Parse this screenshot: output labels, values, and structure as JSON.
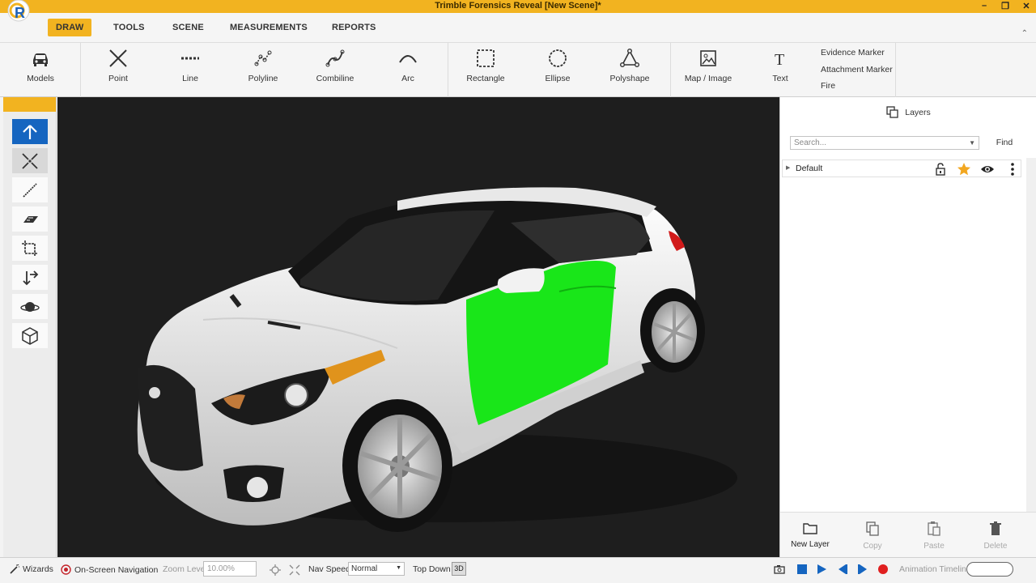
{
  "window": {
    "title": "Trimble Forensics Reveal [New Scene]*",
    "controls": [
      "minimize",
      "restore",
      "close"
    ]
  },
  "menu": {
    "tabs": [
      {
        "label": "DRAW",
        "active": true
      },
      {
        "label": "TOOLS"
      },
      {
        "label": "SCENE"
      },
      {
        "label": "MEASUREMENTS"
      },
      {
        "label": "REPORTS"
      }
    ],
    "accent_color": "#f2b320"
  },
  "ribbon": {
    "buttons": [
      {
        "label": "Models",
        "icon": "car-icon"
      },
      {
        "label": "Point",
        "icon": "x-point-icon"
      },
      {
        "label": "Line",
        "icon": "dashed-line-icon"
      },
      {
        "label": "Polyline",
        "icon": "polyline-icon"
      },
      {
        "label": "Combiline",
        "icon": "combiline-icon"
      },
      {
        "label": "Arc",
        "icon": "arc-icon"
      },
      {
        "label": "Rectangle",
        "icon": "rectangle-icon"
      },
      {
        "label": "Ellipse",
        "icon": "ellipse-icon"
      },
      {
        "label": "Polyshape",
        "icon": "polyshape-icon"
      },
      {
        "label": "Map / Image",
        "icon": "image-icon"
      },
      {
        "label": "Text",
        "icon": "text-icon"
      }
    ],
    "links": [
      "Evidence Marker",
      "Attachment Marker",
      "Fire"
    ]
  },
  "left_toolbar": {
    "tools": [
      {
        "name": "select-tool",
        "icon": "arrow-up-icon",
        "selected": true
      },
      {
        "name": "collapse-tool",
        "icon": "collapse-arrows-icon",
        "highlighted": true
      },
      {
        "name": "measure-tool",
        "icon": "diagonal-line-icon"
      },
      {
        "name": "ruler-tool",
        "icon": "ruler-icon"
      },
      {
        "name": "crop-tool",
        "icon": "crop-icon"
      },
      {
        "name": "move-tool",
        "icon": "move-arrows-icon"
      },
      {
        "name": "orbit-tool",
        "icon": "orbit-icon"
      },
      {
        "name": "cube-tool",
        "icon": "cube-icon"
      }
    ]
  },
  "viewport": {
    "background": "#1e1e1e",
    "highlight_color": "#19e619"
  },
  "layers_panel": {
    "header": "Layers",
    "search_placeholder": "Search...",
    "find_label": "Find",
    "layers": [
      {
        "name": "Default",
        "locked": false,
        "starred": true,
        "visible": true
      }
    ],
    "actions": [
      {
        "label": "New Layer",
        "icon": "folder-icon",
        "enabled": true
      },
      {
        "label": "Copy",
        "icon": "copy-icon",
        "enabled": false
      },
      {
        "label": "Paste",
        "icon": "paste-icon",
        "enabled": false
      },
      {
        "label": "Delete",
        "icon": "trash-icon",
        "enabled": false
      }
    ]
  },
  "status_bar": {
    "wizards": "Wizards",
    "onscreen_nav": "On-Screen Navigation",
    "zoom_label": "Zoom Level",
    "zoom_value": "10.00%",
    "nav_speed_label": "Nav Speed",
    "nav_speed_value": "Normal",
    "top_down": "Top Down",
    "view_3d": "3D",
    "animation_timeline": "Animation Timeline"
  }
}
